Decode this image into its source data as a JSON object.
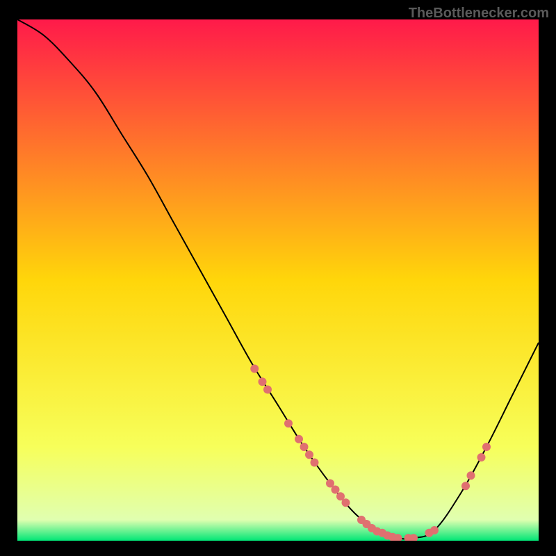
{
  "watermark": "TheBottlenecker.com",
  "chart_data": {
    "type": "line",
    "title": "",
    "xlabel": "",
    "ylabel": "",
    "xlim": [
      0,
      100
    ],
    "ylim": [
      0,
      100
    ],
    "gradient_stops": [
      {
        "offset": 0,
        "color": "#ff1a4a"
      },
      {
        "offset": 50,
        "color": "#ffd60a"
      },
      {
        "offset": 82,
        "color": "#f7ff5a"
      },
      {
        "offset": 96,
        "color": "#e0ffb0"
      },
      {
        "offset": 100,
        "color": "#00e676"
      }
    ],
    "curve": [
      {
        "x": 0,
        "y": 100
      },
      {
        "x": 5,
        "y": 97
      },
      {
        "x": 10,
        "y": 92
      },
      {
        "x": 15,
        "y": 86
      },
      {
        "x": 20,
        "y": 78
      },
      {
        "x": 25,
        "y": 70
      },
      {
        "x": 30,
        "y": 61
      },
      {
        "x": 35,
        "y": 52
      },
      {
        "x": 40,
        "y": 43
      },
      {
        "x": 45,
        "y": 34
      },
      {
        "x": 50,
        "y": 26
      },
      {
        "x": 55,
        "y": 18
      },
      {
        "x": 60,
        "y": 11
      },
      {
        "x": 65,
        "y": 5
      },
      {
        "x": 70,
        "y": 1.5
      },
      {
        "x": 73,
        "y": 0.5
      },
      {
        "x": 76,
        "y": 0.5
      },
      {
        "x": 80,
        "y": 2
      },
      {
        "x": 85,
        "y": 9
      },
      {
        "x": 90,
        "y": 18
      },
      {
        "x": 95,
        "y": 28
      },
      {
        "x": 100,
        "y": 38
      }
    ],
    "dots": [
      {
        "x": 45.5,
        "y": 33
      },
      {
        "x": 47,
        "y": 30.5
      },
      {
        "x": 48,
        "y": 29
      },
      {
        "x": 52,
        "y": 22.5
      },
      {
        "x": 54,
        "y": 19.5
      },
      {
        "x": 55,
        "y": 18
      },
      {
        "x": 56,
        "y": 16.5
      },
      {
        "x": 57,
        "y": 15
      },
      {
        "x": 60,
        "y": 11
      },
      {
        "x": 61,
        "y": 9.8
      },
      {
        "x": 62,
        "y": 8.5
      },
      {
        "x": 63,
        "y": 7.3
      },
      {
        "x": 66,
        "y": 4
      },
      {
        "x": 67,
        "y": 3.2
      },
      {
        "x": 68,
        "y": 2.4
      },
      {
        "x": 69,
        "y": 1.8
      },
      {
        "x": 70,
        "y": 1.5
      },
      {
        "x": 71,
        "y": 1
      },
      {
        "x": 72,
        "y": 0.7
      },
      {
        "x": 73,
        "y": 0.5
      },
      {
        "x": 75,
        "y": 0.5
      },
      {
        "x": 76,
        "y": 0.5
      },
      {
        "x": 79,
        "y": 1.5
      },
      {
        "x": 80,
        "y": 2
      },
      {
        "x": 86,
        "y": 10.5
      },
      {
        "x": 87,
        "y": 12.5
      },
      {
        "x": 89,
        "y": 16
      },
      {
        "x": 90,
        "y": 18
      }
    ],
    "dot_color": "#e07070",
    "dot_radius": 6,
    "curve_color": "#000000",
    "curve_width": 2
  }
}
